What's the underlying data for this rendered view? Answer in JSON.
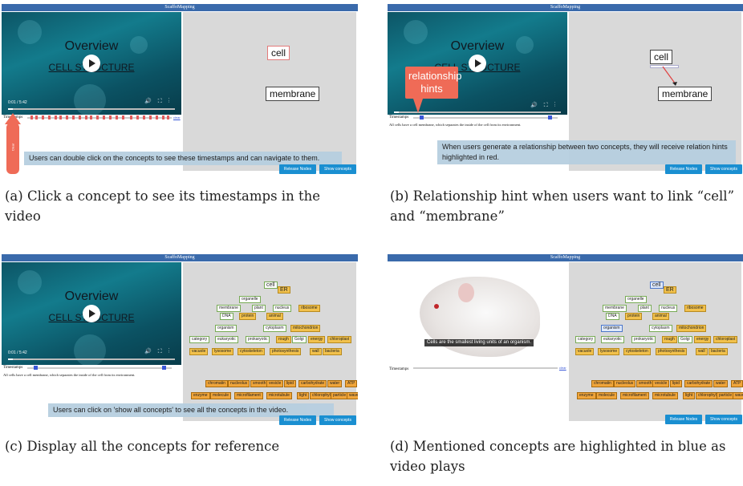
{
  "app_title": "ScaffoMapping",
  "video": {
    "title": "Overview",
    "subtitle": "CELL STRUCTURE",
    "time": "0:01 / 5:42"
  },
  "timestamps_label": "Timestamps",
  "timestamps_link": "clear",
  "transcript": "All cells have a cell membrane, which separates the inside of the cell from its environment.",
  "buttons": {
    "release": "Release Nodes",
    "show": "Show concepts"
  },
  "panels": {
    "a": {
      "nodes": {
        "cell": "cell",
        "membrane": "membrane"
      },
      "tip": "Users can double click on the concepts to see these timestamps and can navigate to them.",
      "arrow_text": "Clear",
      "caption": "(a) Click a concept to see its timestamps in the video"
    },
    "b": {
      "nodes": {
        "cell": "cell",
        "membrane": "membrane"
      },
      "callout": "relationship hints",
      "tip": "When users generate a relationship between two concepts, they will receive relation hints highlighted in red.",
      "caption": "(b) Relationship hint when users want to link “cell” and “membrane”"
    },
    "c": {
      "tip": "Users can click on 'show all concepts' to see all the concepts in the video.",
      "caption": "(c) Display all the concepts for reference"
    },
    "d": {
      "mouse_caption": "Cells are the smallest living units of an organism.",
      "caption": "(d) Mentioned concepts are highlighted in blue as video plays"
    }
  },
  "concepts": {
    "top": [
      "cell",
      "ER",
      "organelle"
    ],
    "row1": [
      "membrane",
      "plant",
      "nucleus",
      "ribosome"
    ],
    "row2": [
      "DNA",
      "protein",
      "animal"
    ],
    "row3": [
      "organism",
      "cytoplasm",
      "mitochondrion"
    ],
    "row4": [
      "category",
      "eukaryotic",
      "prokaryotic",
      "rough",
      "Golgi",
      "energy",
      "chloroplast"
    ],
    "row5": [
      "vacuole",
      "lysosome",
      "cytoskeleton",
      "photosynthesis",
      "wall",
      "bacteria"
    ],
    "row6": [
      "chromatin",
      "nucleolus",
      "smooth",
      "vesicle",
      "lipid",
      "carbohydrate",
      "water",
      "ATP"
    ],
    "row7": [
      "enzyme",
      "molecule",
      "microfilament",
      "microtubule",
      "light",
      "chlorophyll",
      "particle",
      "wave"
    ]
  },
  "colors": {
    "titlebar": "#3a6aab",
    "button": "#1a8fd1",
    "hint_red": "#ef6b57",
    "tip_bg": "#b7cfe0"
  }
}
